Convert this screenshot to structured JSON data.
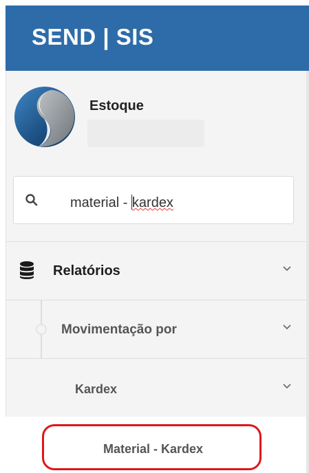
{
  "header": {
    "title": "SEND | SIS"
  },
  "user": {
    "name": "Estoque"
  },
  "search": {
    "value_before": "material - ",
    "value_after": "kardex",
    "icon": "search-icon"
  },
  "menu": {
    "relatorios": {
      "label": "Relatórios",
      "icon": "database-icon"
    },
    "movimentacao": {
      "label": "Movimentação por"
    },
    "kardex": {
      "label": "Kardex"
    },
    "material_kardex": {
      "label": "Material - Kardex"
    }
  },
  "colors": {
    "brand": "#2d6ca8",
    "highlight": "#e0141b"
  }
}
